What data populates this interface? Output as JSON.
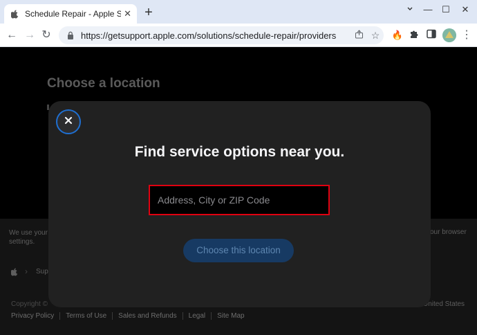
{
  "browser": {
    "tab_title": "Schedule Repair - Apple Support",
    "tab_close": "✕",
    "new_tab": "+",
    "window_controls": {
      "minimize": "—",
      "maximize": "☐",
      "close": "✕"
    },
    "url": "https://getsupport.apple.com/solutions/schedule-repair/providers",
    "nav": {
      "back": "←",
      "forward": "→",
      "reload": "↻"
    }
  },
  "background": {
    "heading": "Choose a location",
    "cookie_left": "We use your settings.",
    "cookie_right": "our browser",
    "breadcrumb": "Sup",
    "copyright": "Copyright ©",
    "country": "United States",
    "footer_links": [
      "Privacy Policy",
      "Terms of Use",
      "Sales and Refunds",
      "Legal",
      "Site Map"
    ]
  },
  "modal": {
    "title": "Find service options near you.",
    "address_placeholder": "Address, City or ZIP Code",
    "address_value": "",
    "choose_button": "Choose this location"
  },
  "colors": {
    "highlight": "#e00010",
    "close_ring": "#1f6fd1",
    "button_bg": "#173a63"
  }
}
